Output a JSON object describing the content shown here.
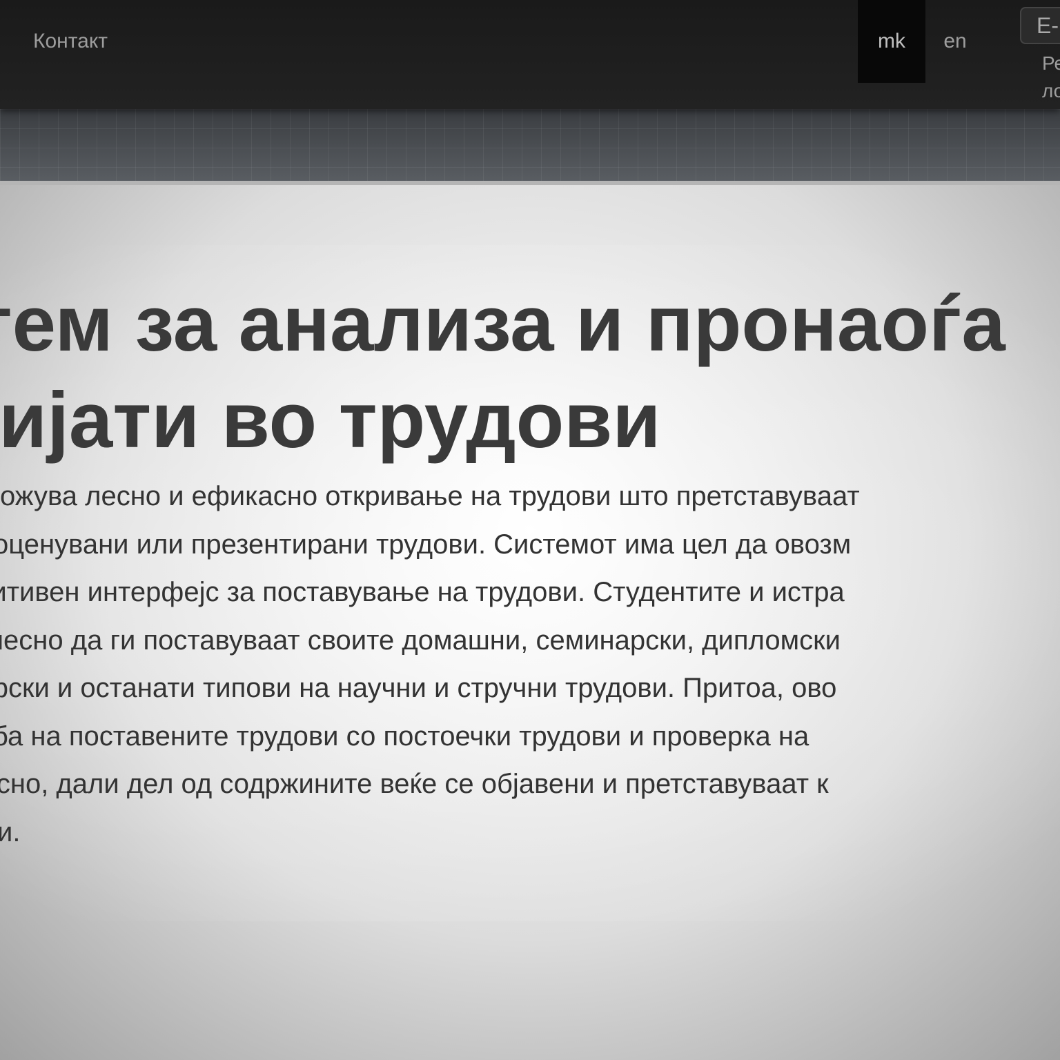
{
  "navbar": {
    "contact_label": "Контакт",
    "languages": [
      "mk",
      "en"
    ],
    "active_language": "mk",
    "login_input_placeholder": "E-",
    "login_label": "Ре\nло"
  },
  "hero": {
    "title_lines": [
      "Систем за анализа и пронаоѓа",
      "плагијати во трудови"
    ],
    "text_lines": [
      "Ова овозможува лесно и ефикасно откривање на трудови што претставуваат",
      "објавени, оценувани или презентирани трудови. Системот има цел да овозм",
      "еден интуитивен интерфејс за поставување на трудови. Студентите и истра",
      "ќе можат лесно да ги поставуваат своите домашни, семинарски, дипломски",
      "ски, докторски и останати типови на научни и стручни трудови. Притоа, ово",
      "ва споредба на поставените трудови со постоечки трудови и проверка на",
      "ноот, односно, дали дел од содржините веќе се објавени и претставуваат к",
      "и содржини."
    ]
  },
  "colors": {
    "navbar_bg": "#1a1a1a",
    "active_lang_bg": "#080808",
    "nav_text": "#9d9d9d",
    "title_text": "#3a3a3a",
    "body_text": "#333333"
  }
}
